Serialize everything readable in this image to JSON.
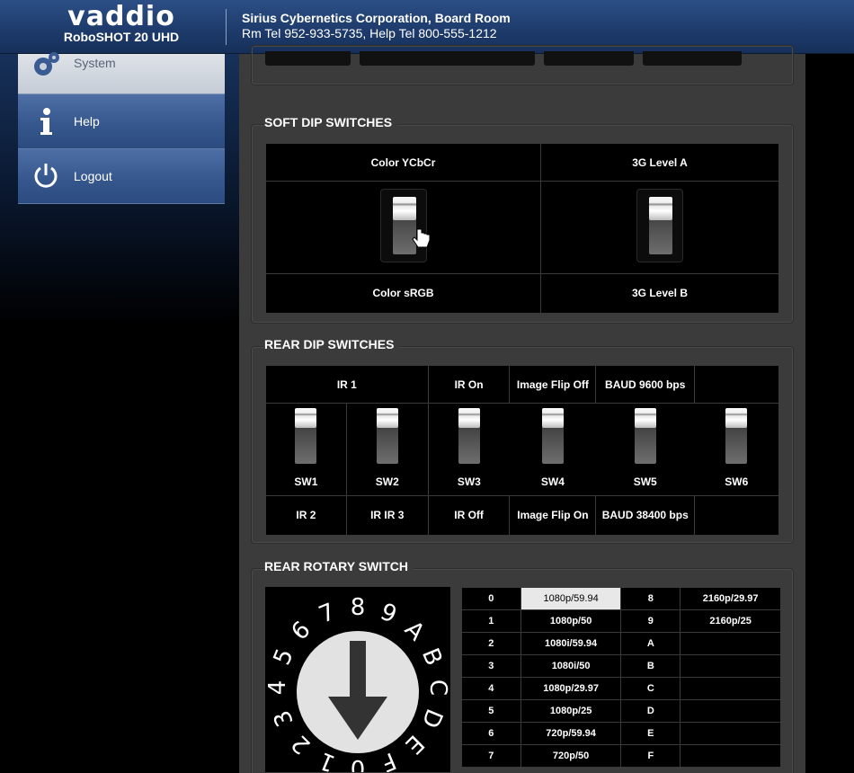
{
  "header": {
    "brand": "vaddio",
    "model": "RoboSHOT 20 UHD",
    "room_name": "Sirius Cybernetics Corporation, Board Room",
    "room_tel": "Rm Tel 952-933-5735, Help Tel 800-555-1212"
  },
  "nav": {
    "items": [
      {
        "label": "System",
        "icon": "gear-icon"
      },
      {
        "label": "Help",
        "icon": "info-icon"
      },
      {
        "label": "Logout",
        "icon": "power-icon"
      }
    ]
  },
  "soft_dip": {
    "title": "SOFT DIP SWITCHES",
    "switches": [
      {
        "top_label": "Color YCbCr",
        "bottom_label": "Color sRGB",
        "position": "up"
      },
      {
        "top_label": "3G Level A",
        "bottom_label": "3G Level B",
        "position": "up"
      }
    ]
  },
  "rear_dip": {
    "title": "REAR DIP SWITCHES",
    "top_labels": [
      "IR 1",
      "IR On",
      "Image Flip Off",
      "BAUD 9600 bps",
      ""
    ],
    "switch_labels": [
      "SW1",
      "SW2",
      "SW3",
      "SW4",
      "SW5",
      "SW6"
    ],
    "bottom_labels": [
      "IR 2",
      "IR IR 3",
      "IR Off",
      "Image Flip On",
      "BAUD 38400 bps",
      ""
    ]
  },
  "rotary": {
    "title": "REAR ROTARY SWITCH",
    "dial_digits": [
      "0",
      "1",
      "2",
      "3",
      "4",
      "5",
      "6",
      "7",
      "8",
      "9",
      "A",
      "B",
      "C",
      "D",
      "E",
      "F"
    ],
    "selected": "0",
    "rows": [
      {
        "k1": "0",
        "v1": "1080p/59.94",
        "k2": "8",
        "v2": "2160p/29.97"
      },
      {
        "k1": "1",
        "v1": "1080p/50",
        "k2": "9",
        "v2": "2160p/25"
      },
      {
        "k1": "2",
        "v1": "1080i/59.94",
        "k2": "A",
        "v2": ""
      },
      {
        "k1": "3",
        "v1": "1080i/50",
        "k2": "B",
        "v2": ""
      },
      {
        "k1": "4",
        "v1": "1080p/29.97",
        "k2": "C",
        "v2": ""
      },
      {
        "k1": "5",
        "v1": "1080p/25",
        "k2": "D",
        "v2": ""
      },
      {
        "k1": "6",
        "v1": "720p/59.94",
        "k2": "E",
        "v2": ""
      },
      {
        "k1": "7",
        "v1": "720p/50",
        "k2": "F",
        "v2": ""
      }
    ]
  }
}
